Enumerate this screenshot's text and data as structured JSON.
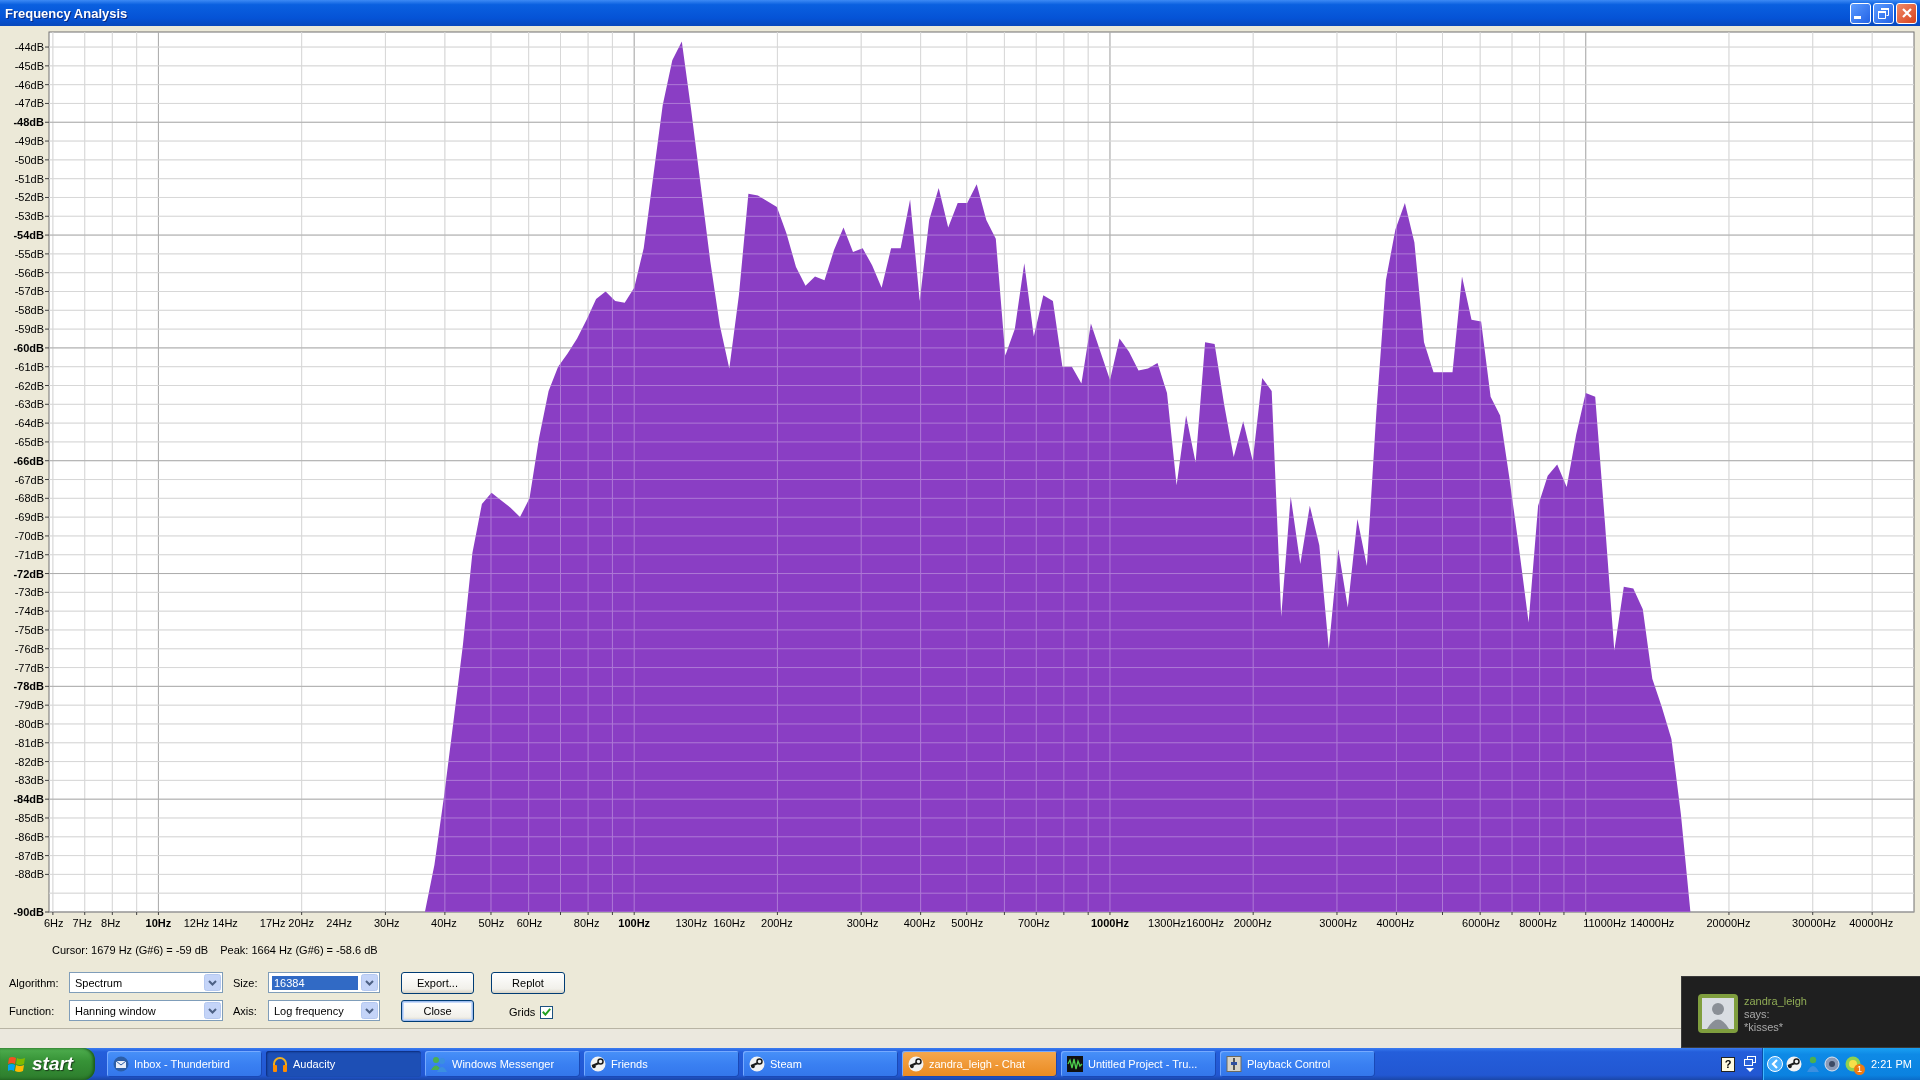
{
  "window": {
    "title": "Frequency Analysis"
  },
  "plot": {
    "chart_data": {
      "type": "area",
      "grid": true,
      "categories": [
        "6Hz",
        null,
        null,
        "7Hz",
        null,
        null,
        "8Hz",
        null,
        null,
        null,
        null,
        "10Hz",
        null,
        null,
        null,
        "12Hz",
        null,
        null,
        "14Hz",
        null,
        null,
        null,
        null,
        "17Hz",
        null,
        null,
        "20Hz",
        null,
        null,
        null,
        "24Hz",
        null,
        null,
        null,
        null,
        "30Hz",
        null,
        null,
        null,
        null,
        null,
        "40Hz",
        null,
        null,
        null,
        null,
        "50Hz",
        null,
        null,
        null,
        "60Hz",
        null,
        null,
        null,
        null,
        null,
        "80Hz",
        null,
        null,
        null,
        null,
        "100Hz",
        null,
        null,
        null,
        null,
        null,
        "130Hz",
        null,
        null,
        null,
        "160Hz",
        null,
        null,
        null,
        null,
        "200Hz",
        null,
        null,
        null,
        null,
        null,
        null,
        null,
        null,
        "300Hz",
        null,
        null,
        null,
        null,
        null,
        "400Hz",
        null,
        null,
        null,
        null,
        "500Hz",
        null,
        null,
        null,
        null,
        null,
        null,
        "700Hz",
        null,
        null,
        null,
        null,
        null,
        null,
        null,
        "1000Hz",
        null,
        null,
        null,
        null,
        null,
        "1300Hz",
        null,
        null,
        null,
        "1600Hz",
        null,
        null,
        null,
        null,
        "2000Hz",
        null,
        null,
        null,
        null,
        null,
        null,
        null,
        null,
        "3000Hz",
        null,
        null,
        null,
        null,
        null,
        "4000Hz",
        null,
        null,
        null,
        null,
        null,
        null,
        null,
        null,
        "6000Hz",
        null,
        null,
        null,
        null,
        null,
        "8000Hz",
        null,
        null,
        null,
        null,
        null,
        null,
        "11000Hz",
        null,
        null,
        null,
        null,
        "14000Hz",
        null,
        null,
        null,
        null,
        null,
        null,
        null,
        "20000Hz",
        null,
        null,
        null,
        null,
        null,
        null,
        null,
        null,
        "30000Hz",
        null,
        null,
        null,
        null,
        null,
        "40000Hz",
        null,
        null,
        null,
        null
      ],
      "series": [
        {
          "color": "#8a3ec4",
          "values": [
            null,
            null,
            null,
            null,
            null,
            null,
            null,
            null,
            null,
            null,
            null,
            null,
            null,
            null,
            null,
            null,
            null,
            null,
            null,
            null,
            null,
            null,
            null,
            null,
            null,
            null,
            null,
            null,
            null,
            null,
            null,
            null,
            null,
            null,
            null,
            null,
            null,
            null,
            null,
            -90,
            -87.5,
            -83.9,
            -79.9,
            -75.8,
            -70.9,
            -68.3,
            -67.7,
            -68.1,
            -68.5,
            -69,
            -68,
            -64.8,
            -62.3,
            -61,
            -60.3,
            -59.5,
            -58.5,
            -57.4,
            -57,
            -57.5,
            -57.6,
            -56.8,
            -54.7,
            -50.9,
            -47.1,
            -44.7,
            -43.7,
            -47.4,
            -51.4,
            -55.4,
            -58.8,
            -61.1,
            -57.2,
            -51.8,
            -51.9,
            -52.2,
            -52.5,
            -53.9,
            -55.7,
            -56.7,
            -56.2,
            -56.4,
            -54.8,
            -53.6,
            -54.9,
            -54.7,
            -55.6,
            -56.8,
            -54.7,
            -54.7,
            -52.1,
            -57.5,
            -53.2,
            -51.5,
            -53.6,
            -52.3,
            -52.3,
            -51.3,
            -53.2,
            -54.2,
            -60.4,
            -59,
            -55.5,
            -59.4,
            -57.2,
            -57.5,
            -61,
            -61,
            -61.9,
            -58.7,
            -60.2,
            -61.7,
            -59.5,
            -60.2,
            -61.2,
            -61.1,
            -60.8,
            -62.4,
            -67.3,
            -63.6,
            -66.1,
            -59.7,
            -59.8,
            -63,
            -65.8,
            -63.9,
            -66,
            -61.6,
            -62.3,
            -74.3,
            -67.9,
            -71.5,
            -68.4,
            -70.5,
            -76,
            -70.7,
            -73.8,
            -69.1,
            -71.6,
            -63.4,
            -56.4,
            -53.7,
            -52.3,
            -54.4,
            -59.7,
            -61.3,
            -61.3,
            -61.3,
            -56.2,
            -58.5,
            -58.6,
            -62.6,
            -63.6,
            -67,
            -70.7,
            -74.6,
            -68.4,
            -66.8,
            -66.2,
            -67.4,
            -64.6,
            -62.4,
            -62.6,
            -69.2,
            -76.1,
            -72.7,
            -72.8,
            -73.9,
            -77.6,
            -79.1,
            -80.8,
            -84.8,
            -90,
            null,
            null,
            null,
            null,
            null,
            null,
            null,
            null,
            null,
            null,
            null,
            null,
            null,
            null,
            null,
            null,
            null,
            null,
            null,
            null,
            null,
            null,
            null
          ]
        }
      ],
      "ylim": [
        -90,
        -43.2
      ],
      "yticks": [
        {
          "value": -44,
          "label": "-44dB"
        },
        {
          "value": -45,
          "label": "-45dB"
        },
        {
          "value": -46,
          "label": "-46dB"
        },
        {
          "value": -47,
          "label": "-47dB"
        },
        {
          "value": -48,
          "label": "-48dB"
        },
        {
          "value": -49,
          "label": "-49dB"
        },
        {
          "value": -50,
          "label": "-50dB"
        },
        {
          "value": -51,
          "label": "-51dB"
        },
        {
          "value": -52,
          "label": "-52dB"
        },
        {
          "value": -53,
          "label": "-53dB"
        },
        {
          "value": -54,
          "label": "-54dB"
        },
        {
          "value": -55,
          "label": "-55dB"
        },
        {
          "value": -56,
          "label": "-56dB"
        },
        {
          "value": -57,
          "label": "-57dB"
        },
        {
          "value": -58,
          "label": "-58dB"
        },
        {
          "value": -59,
          "label": "-59dB"
        },
        {
          "value": -60,
          "label": "-60dB"
        },
        {
          "value": -61,
          "label": "-61dB"
        },
        {
          "value": -62,
          "label": "-62dB"
        },
        {
          "value": -63,
          "label": "-63dB"
        },
        {
          "value": -64,
          "label": "-64dB"
        },
        {
          "value": -65,
          "label": "-65dB"
        },
        {
          "value": -66,
          "label": "-66dB"
        },
        {
          "value": -67,
          "label": "-67dB"
        },
        {
          "value": -68,
          "label": "-68dB"
        },
        {
          "value": -69,
          "label": "-69dB"
        },
        {
          "value": -70,
          "label": "-70dB"
        },
        {
          "value": -71,
          "label": "-71dB"
        },
        {
          "value": -72,
          "label": "-72dB"
        },
        {
          "value": -73,
          "label": "-73dB"
        },
        {
          "value": -74,
          "label": "-74dB"
        },
        {
          "value": -75,
          "label": "-75dB"
        },
        {
          "value": -76,
          "label": "-76dB"
        },
        {
          "value": -77,
          "label": "-77dB"
        },
        {
          "value": -78,
          "label": "-78dB"
        },
        {
          "value": -79,
          "label": "-79dB"
        },
        {
          "value": -80,
          "label": "-80dB"
        },
        {
          "value": -81,
          "label": "-81dB"
        },
        {
          "value": -82,
          "label": "-82dB"
        },
        {
          "value": -83,
          "label": "-83dB"
        },
        {
          "value": -84,
          "label": "-84dB"
        },
        {
          "value": -85,
          "label": "-85dB"
        },
        {
          "value": -86,
          "label": "-86dB"
        },
        {
          "value": -87,
          "label": "-87dB"
        },
        {
          "value": -88,
          "label": "-88dB"
        },
        {
          "value": -90,
          "label": "-90dB"
        }
      ]
    }
  },
  "status": {
    "cursor": "Cursor: 1679 Hz (G#6) = -59 dB",
    "peak": "Peak: 1664 Hz (G#6) = -58.6 dB"
  },
  "controls": {
    "dropdowns": [
      {
        "label": "Algorithm:",
        "value": "Spectrum",
        "focused": false
      },
      {
        "label": "Size:",
        "value": "16384",
        "focused": true
      },
      {
        "label": "Function:",
        "value": "Hanning window",
        "focused": false
      },
      {
        "label": "Axis:",
        "value": "Log frequency",
        "focused": false
      }
    ],
    "buttons": [
      {
        "label": "Export...",
        "default": false
      },
      {
        "label": "Replot",
        "default": false
      },
      {
        "label": "Close",
        "default": true
      }
    ],
    "grids": {
      "label": "Grids",
      "checked": true
    }
  },
  "notification": {
    "sender": "zandra_leigh",
    "verb": "says:",
    "message": "*kisses*"
  },
  "taskbar": {
    "start": "start",
    "items": [
      {
        "label": "Inbox - Thunderbird",
        "kind": "mail",
        "selected": false,
        "flashing": false
      },
      {
        "label": "Audacity",
        "kind": "headphones",
        "selected": true,
        "flashing": false
      },
      {
        "label": "Windows Messenger",
        "kind": "buddy",
        "selected": false,
        "flashing": false
      },
      {
        "label": "Friends",
        "kind": "lever",
        "selected": false,
        "flashing": false
      },
      {
        "label": "Steam",
        "kind": "lever",
        "selected": false,
        "flashing": false
      },
      {
        "label": "zandra_leigh - Chat",
        "kind": "lever",
        "selected": false,
        "flashing": true
      },
      {
        "label": "Untitled Project - Tru...",
        "kind": "wave",
        "selected": false,
        "flashing": false
      },
      {
        "label": "Playback Control",
        "kind": "mixer",
        "selected": false,
        "flashing": false
      }
    ],
    "help": "?",
    "tray_badge": "1",
    "clock": "2:21 PM"
  }
}
